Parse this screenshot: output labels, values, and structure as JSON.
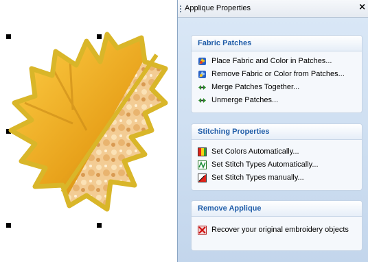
{
  "canvas": {
    "selection_handles": 6,
    "object": "leaf-applique-embroidery"
  },
  "panel": {
    "title": "Applique Properties",
    "close_glyph": "×",
    "groups": [
      {
        "title": "Fabric Patches",
        "items": [
          {
            "label": "Place Fabric and Color in Patches...",
            "icon": "color-patch-icon"
          },
          {
            "label": "Remove Fabric or Color from Patches...",
            "icon": "color-patch-remove-icon"
          },
          {
            "label": "Merge Patches Together...",
            "icon": "merge-arrows-icon"
          },
          {
            "label": "Unmerge Patches...",
            "icon": "unmerge-arrows-icon"
          }
        ]
      },
      {
        "title": "Stitching Properties",
        "items": [
          {
            "label": "Set Colors Automatically...",
            "icon": "color-bars-icon"
          },
          {
            "label": "Set Stitch Types Automatically...",
            "icon": "stitch-auto-icon"
          },
          {
            "label": "Set Stitch Types manually...",
            "icon": "stitch-manual-icon"
          }
        ]
      },
      {
        "title": "Remove Applique",
        "items": [
          {
            "label": "Recover your original embroidery objects",
            "icon": "remove-x-icon"
          }
        ]
      }
    ]
  }
}
